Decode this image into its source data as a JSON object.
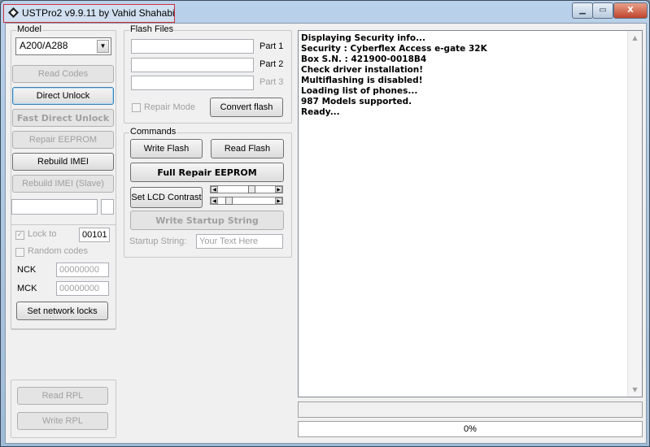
{
  "window": {
    "title": "USTPro2 v9.9.11   by Vahid Shahabi",
    "minimize": "▁",
    "maximize": "▭",
    "close": "X"
  },
  "model_group": {
    "label": "Model",
    "selected": "A200/A288",
    "buttons": {
      "read_codes": "Read Codes",
      "direct_unlock": "Direct Unlock",
      "fast_direct_unlock": "Fast Direct Unlock",
      "repair_eeprom": "Repair EEPROM",
      "rebuild_imei": "Rebuild IMEI",
      "rebuild_imei_slave": "Rebuild IMEI (Slave)"
    }
  },
  "lock_group": {
    "lock_to_label": "Lock to",
    "lock_to_value": "00101",
    "random_codes_label": "Random codes",
    "nck_label": "NCK",
    "nck_value": "00000000",
    "mck_label": "MCK",
    "mck_value": "00000000",
    "set_network_locks": "Set network locks"
  },
  "rpl_group": {
    "read_rpl": "Read RPL",
    "write_rpl": "Write RPL"
  },
  "flash_group": {
    "label": "Flash Files",
    "part1": "Part 1",
    "part2": "Part 2",
    "part3": "Part 3",
    "repair_mode": "Repair Mode",
    "convert_flash": "Convert flash"
  },
  "commands_group": {
    "label": "Commands",
    "write_flash": "Write Flash",
    "read_flash": "Read Flash",
    "full_repair_eeprom": "Full Repair EEPROM",
    "set_lcd_contrast": "Set LCD Contrast",
    "write_startup_string": "Write Startup String",
    "startup_string_label": "Startup String:",
    "startup_string_placeholder": "Your Text Here"
  },
  "log": {
    "lines": [
      "Displaying Security info...",
      "Security : Cyberflex Access e-gate 32K",
      "Box S.N. : 421900-0018B4",
      "Check driver installation!",
      "Multiflashing is disabled!",
      "Loading list of phones...",
      "987  Models supported.",
      "Ready..."
    ]
  },
  "progress": {
    "text": "0%",
    "value": 0
  }
}
